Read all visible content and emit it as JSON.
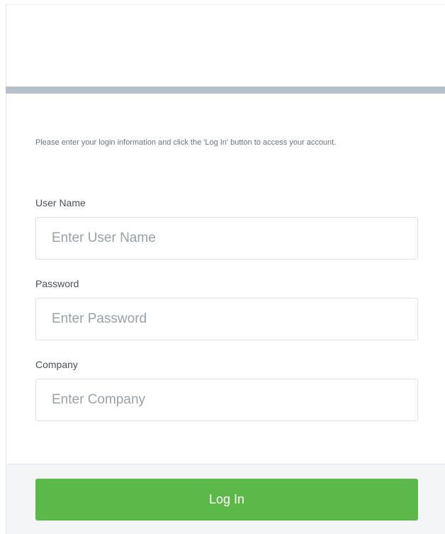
{
  "intro_text": "Please enter your login information and click the 'Log In' button to access your account.",
  "fields": {
    "username": {
      "label": "User Name",
      "placeholder": "Enter User Name",
      "value": ""
    },
    "password": {
      "label": "Password",
      "placeholder": "Enter Password",
      "value": ""
    },
    "company": {
      "label": "Company",
      "placeholder": "Enter Company",
      "value": ""
    }
  },
  "login_button": {
    "label": "Log In"
  },
  "colors": {
    "accent_bar": "#b6c1cc",
    "login_button": "#5db84a",
    "footer_background": "#f3f5f7"
  }
}
